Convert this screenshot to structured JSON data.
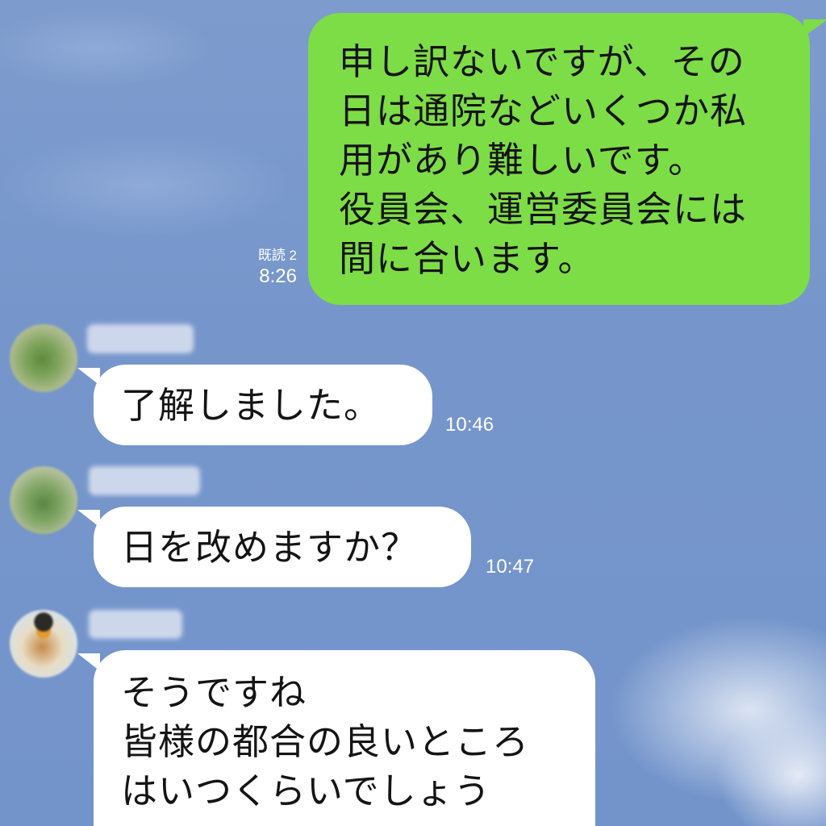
{
  "chat": {
    "messages": [
      {
        "id": "m1",
        "direction": "sent",
        "text": "申し訳ないですが、その\n日は通院などいくつか私\n用があり難しいです。\n役員会、運営委員会には\n間に合います。",
        "read_label": "既読 2",
        "time": "8:26"
      },
      {
        "id": "m2",
        "direction": "received",
        "text": "了解しました。",
        "time": "10:46"
      },
      {
        "id": "m3",
        "direction": "received",
        "text": "日を改めますか？",
        "time": "10:47"
      },
      {
        "id": "m4",
        "direction": "received",
        "text": "そうですね\n皆様の都合の良いところ\nはいつくらいでしょう"
      }
    ]
  },
  "colors": {
    "background": "#7394cb",
    "sent_bubble": "#7ddd46",
    "received_bubble": "#ffffff",
    "meta_text": "#ffffff"
  }
}
